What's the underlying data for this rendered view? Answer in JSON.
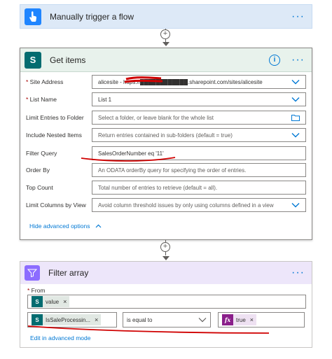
{
  "trigger": {
    "title": "Manually trigger a flow",
    "more": "···"
  },
  "get_items": {
    "title": "Get items",
    "info": "i",
    "more": "···",
    "fields": [
      {
        "label": "Site Address",
        "required": true,
        "value": "alicesite - https://████████████.sharepoint.com/sites/alicesite",
        "type": "dropdown"
      },
      {
        "label": "List Name",
        "required": true,
        "value": "List 1",
        "type": "dropdown"
      },
      {
        "label": "Limit Entries to Folder",
        "required": false,
        "placeholder": "Select a folder, or leave blank for the whole list",
        "type": "folder"
      },
      {
        "label": "Include Nested Items",
        "required": false,
        "placeholder": "Return entries contained in sub-folders (default = true)",
        "type": "dropdown"
      },
      {
        "label": "Filter Query",
        "required": false,
        "value": "SalesOrderNumber eq '11'",
        "type": "text"
      },
      {
        "label": "Order By",
        "required": false,
        "placeholder": "An ODATA orderBy query for specifying the order of entries.",
        "type": "text"
      },
      {
        "label": "Top Count",
        "required": false,
        "placeholder": "Total number of entries to retrieve (default = all).",
        "type": "text"
      },
      {
        "label": "Limit Columns by View",
        "required": false,
        "placeholder": "Avoid column threshold issues by only using columns defined in a view",
        "type": "dropdown"
      }
    ],
    "hide_advanced": "Hide advanced options"
  },
  "filter_array": {
    "title": "Filter array",
    "more": "···",
    "from_label": "From",
    "from_token": "value",
    "left_token": "IsSaleProcessin...",
    "operator": "is equal to",
    "right_token": "true",
    "edit_advanced": "Edit in advanced mode"
  },
  "colors": {
    "accent": "#0078d4",
    "sharepoint": "#036c70",
    "trigger_bg": "#dde9f7",
    "filter_bg": "#ede6fa",
    "annotation_red": "#d00000"
  }
}
